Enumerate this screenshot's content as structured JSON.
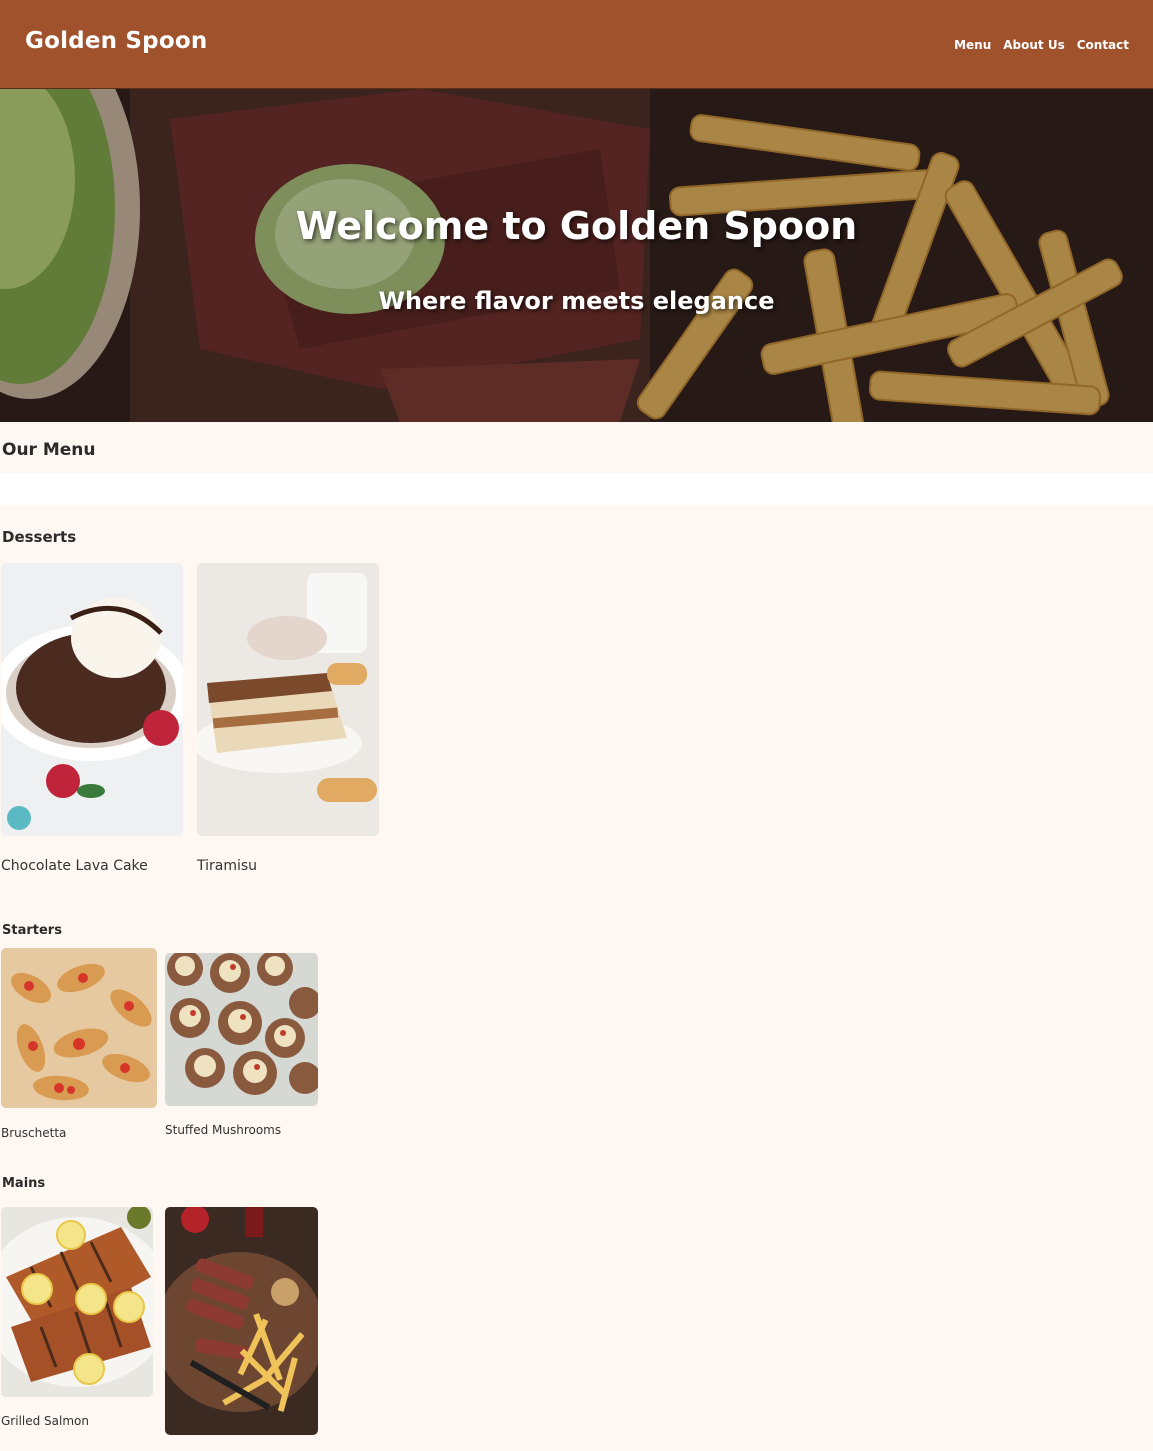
{
  "header": {
    "brand": "Golden Spoon",
    "nav": [
      "Menu",
      "About Us",
      "Contact"
    ]
  },
  "hero": {
    "title": "Welcome to Golden Spoon",
    "subtitle": "Where flavor meets elegance"
  },
  "menu": {
    "title": "Our Menu",
    "categories": [
      {
        "name": "Desserts",
        "items": [
          "Chocolate Lava Cake",
          "Tiramisu"
        ]
      },
      {
        "name": "Starters",
        "items": [
          "Bruschetta",
          "Stuffed Mushrooms"
        ]
      },
      {
        "name": "Mains",
        "items": [
          "Grilled Salmon",
          ""
        ]
      }
    ]
  },
  "colors": {
    "header_bg": "#a0522d",
    "section_bg": "#fff7f1",
    "text": "#2b2b2b"
  }
}
